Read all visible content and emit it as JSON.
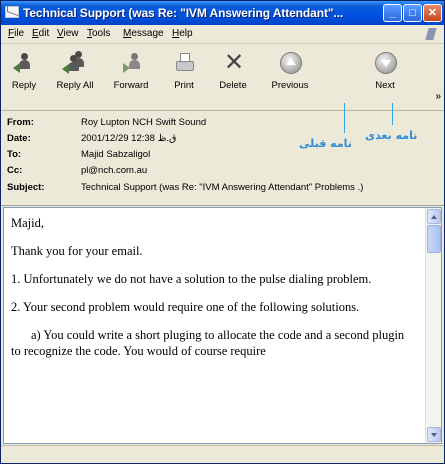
{
  "window": {
    "title": "Technical Support (was Re: \"IVM Answering Attendant\"..."
  },
  "menu": [
    "File",
    "Edit",
    "View",
    "Tools",
    "Message",
    "Help"
  ],
  "menu_mnemonics": [
    "F",
    "E",
    "V",
    "T",
    "M",
    "H"
  ],
  "toolbar": {
    "reply": "Reply",
    "reply_all": "Reply All",
    "forward": "Forward",
    "print": "Print",
    "delete": "Delete",
    "previous": "Previous",
    "next": "Next",
    "overflow": "»"
  },
  "annotations": {
    "next_message": "نامه بعدی",
    "previous_message": "نامه قبلی"
  },
  "headers": {
    "from_label": "From:",
    "from": "Roy Lupton NCH Swift Sound",
    "date_label": "Date:",
    "date": "2001/12/29 12:38 ق.ظ",
    "to_label": "To:",
    "to": "Majid Sabzaligol",
    "cc_label": "Cc:",
    "cc": "pl@nch.com.au",
    "subject_label": "Subject:",
    "subject": "Technical Support (was Re: \"IVM Answering Attendant\" Problems .)"
  },
  "body": {
    "p1": "Majid,",
    "p2": "Thank you for your email.",
    "p3": "1. Unfortunately we do not have a solution to the pulse dialing problem.",
    "p4": "2.  Your second problem would require one of the following solutions.",
    "p5": "a) You could write a short pluging to allocate the code and a second plugin to recognize the code. You would of course require"
  }
}
